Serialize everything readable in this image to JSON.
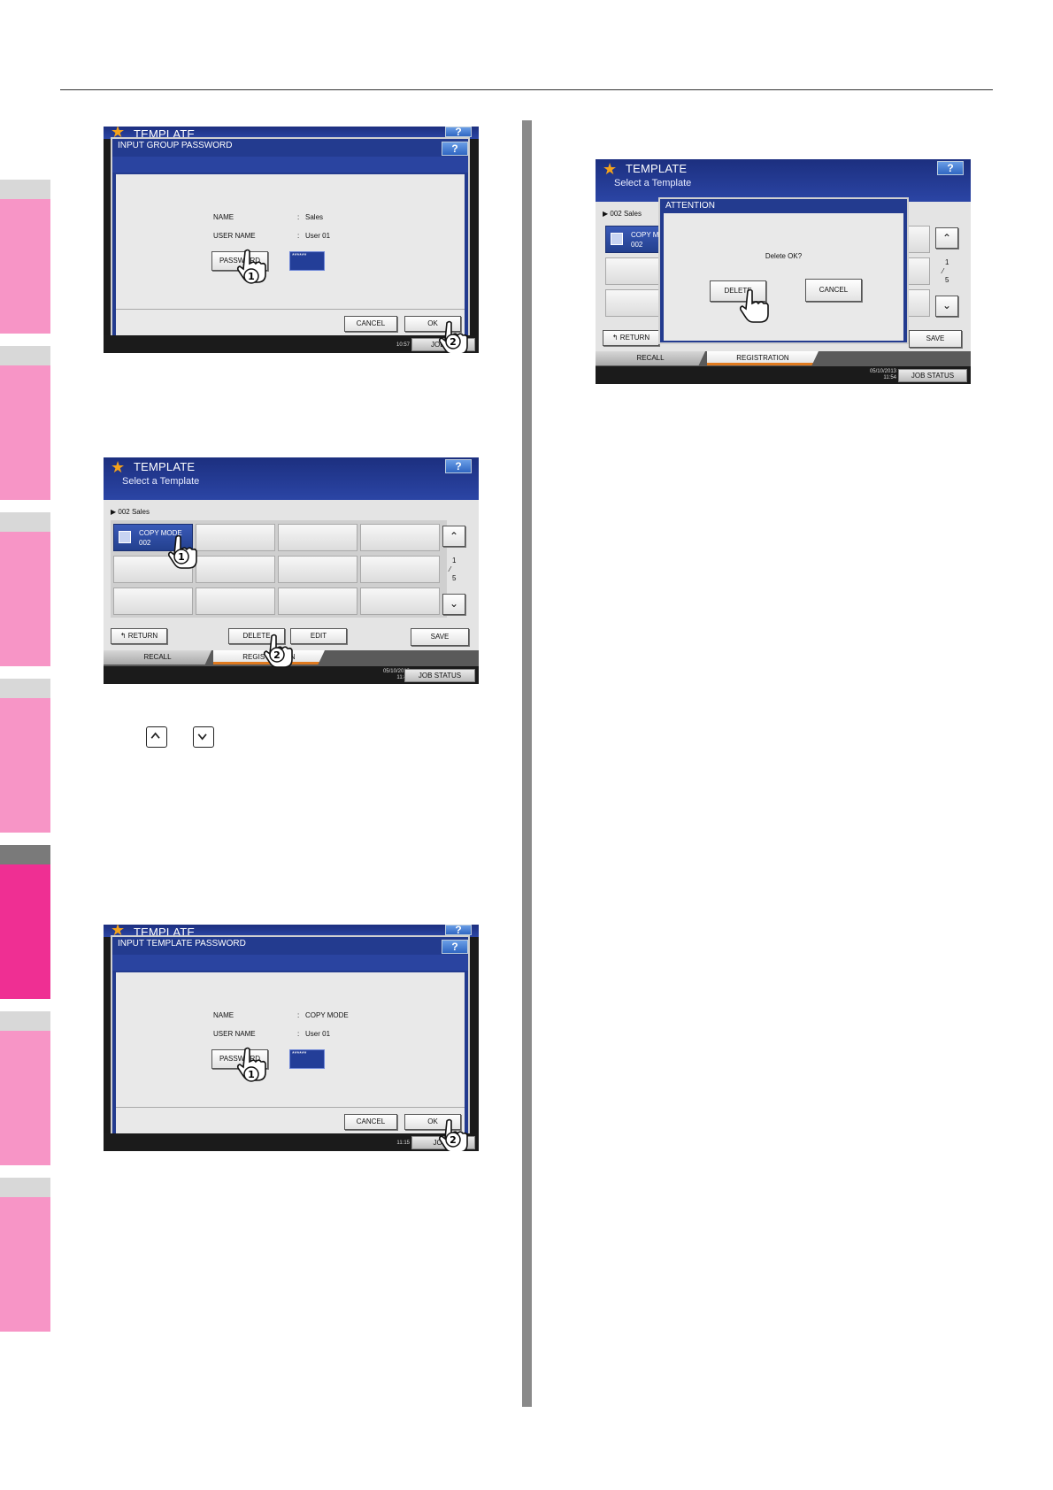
{
  "screens": {
    "group_password": {
      "bg_title": "TEMPLATE",
      "dialog_title": "INPUT GROUP PASSWORD",
      "help": "?",
      "name_label": "NAME",
      "name_value": "Sales",
      "user_label": "USER NAME",
      "user_value": "User 01",
      "password_button": "PASSWORD",
      "password_mask": "******",
      "cancel": "CANCEL",
      "ok": "OK",
      "time": "10:57",
      "job_status": "JOB ST",
      "step1": "1",
      "step2": "2"
    },
    "select_template": {
      "title": "TEMPLATE",
      "subtitle": "Select a Template",
      "help": "?",
      "group": "002  Sales",
      "tile_line1": "COPY MODE",
      "tile_line2": "002",
      "page_current": "1",
      "page_total": "5",
      "return": "RETURN",
      "delete": "DELETE",
      "edit": "EDIT",
      "save": "SAVE",
      "tab_recall": "RECALL",
      "tab_registration": "REGISTRATION",
      "date": "05/10/2013",
      "time": "11:49",
      "job_status": "JOB STATUS",
      "step1": "1",
      "step2": "2"
    },
    "template_password": {
      "bg_title": "TEMPLATE",
      "dialog_title": "INPUT TEMPLATE PASSWORD",
      "help": "?",
      "name_label": "NAME",
      "name_value": "COPY MODE",
      "user_label": "USER NAME",
      "user_value": "User 01",
      "password_button": "PASSWORD",
      "password_mask": "******",
      "cancel": "CANCEL",
      "ok": "OK",
      "time": "11:15",
      "job_status": "JOB S",
      "step1": "1",
      "step2": "2"
    },
    "attention": {
      "title": "TEMPLATE",
      "subtitle": "Select a Template",
      "help": "?",
      "group": "002  Sales",
      "tile_line1": "COPY M",
      "tile_line2": "002",
      "page_current": "1",
      "page_total": "5",
      "return": "RETURN",
      "save": "SAVE",
      "dialog_title": "ATTENTION",
      "message": "Delete OK?",
      "delete": "DELETE",
      "cancel": "CANCEL",
      "tab_recall": "RECALL",
      "tab_registration": "REGISTRATION",
      "date": "05/10/2013",
      "time": "11:54",
      "job_status": "JOB STATUS"
    }
  },
  "colors": {
    "tab_pink": "#f795c6",
    "tab_active": "#ef2f93",
    "header_blue": "#233b8f"
  }
}
